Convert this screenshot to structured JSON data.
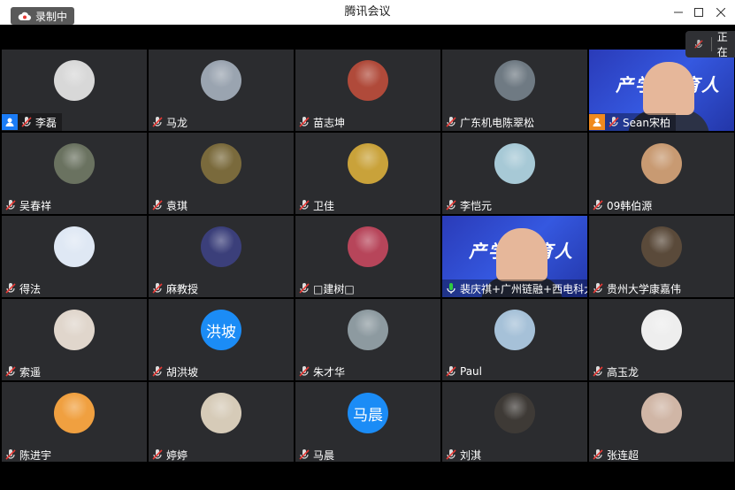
{
  "window": {
    "title": "腾讯会议"
  },
  "recording": {
    "label": "录制中"
  },
  "notification": {
    "label": "正在"
  },
  "colors": {
    "accent": "#1b8cf6",
    "tile_bg": "#2b2c2f",
    "host_badge": "#1b7cf6",
    "cohost_badge": "#f08a1e"
  },
  "participants": [
    {
      "name": "李磊",
      "avatar_color": "#d8d8d8",
      "badge": "host"
    },
    {
      "name": "马龙",
      "avatar_color": "#9aa4b0"
    },
    {
      "name": "苗志坤",
      "avatar_color": "#b04a3a"
    },
    {
      "name": "广东机电陈翠松",
      "avatar_color": "#6f7a83"
    },
    {
      "name": "Sean宋柏",
      "badge": "cohost",
      "screen": true,
      "slide_text": "产学合 育人"
    },
    {
      "name": "吴春祥",
      "avatar_color": "#6a7260"
    },
    {
      "name": "袁琪",
      "avatar_color": "#7a6a3c"
    },
    {
      "name": "卫佳",
      "avatar_color": "#c9a23a"
    },
    {
      "name": "李恺元",
      "avatar_color": "#a7c9d6"
    },
    {
      "name": "09韩伯源",
      "avatar_color": "#c89a72"
    },
    {
      "name": "得法",
      "avatar_color": "#dfe8f4"
    },
    {
      "name": "麻教授",
      "avatar_color": "#3b3f7a"
    },
    {
      "name": "□建树□",
      "avatar_color": "#b7455a"
    },
    {
      "name": "裴庆祺+广州链融+西电科大",
      "screen": true,
      "mic_active": true,
      "slide_text": "产学合 育人"
    },
    {
      "name": "贵州大学康嘉伟",
      "avatar_color": "#5a4a3a"
    },
    {
      "name": "索遥",
      "avatar_color": "#e0d6cc"
    },
    {
      "name": "胡洪坡",
      "avatar_text": "洪坡"
    },
    {
      "name": "朱才华",
      "avatar_color": "#8d9aa0"
    },
    {
      "name": "Paul",
      "avatar_color": "#a6c1d8"
    },
    {
      "name": "高玉龙",
      "avatar_color": "#eeeeee"
    },
    {
      "name": "陈进宇",
      "avatar_color": "#f0a040"
    },
    {
      "name": "婷婷",
      "avatar_color": "#d6cbb8"
    },
    {
      "name": "马晨",
      "avatar_text": "马晨"
    },
    {
      "name": "刘淇",
      "avatar_color": "#3e3a36"
    },
    {
      "name": "张连超",
      "avatar_color": "#d0b6a6"
    }
  ]
}
